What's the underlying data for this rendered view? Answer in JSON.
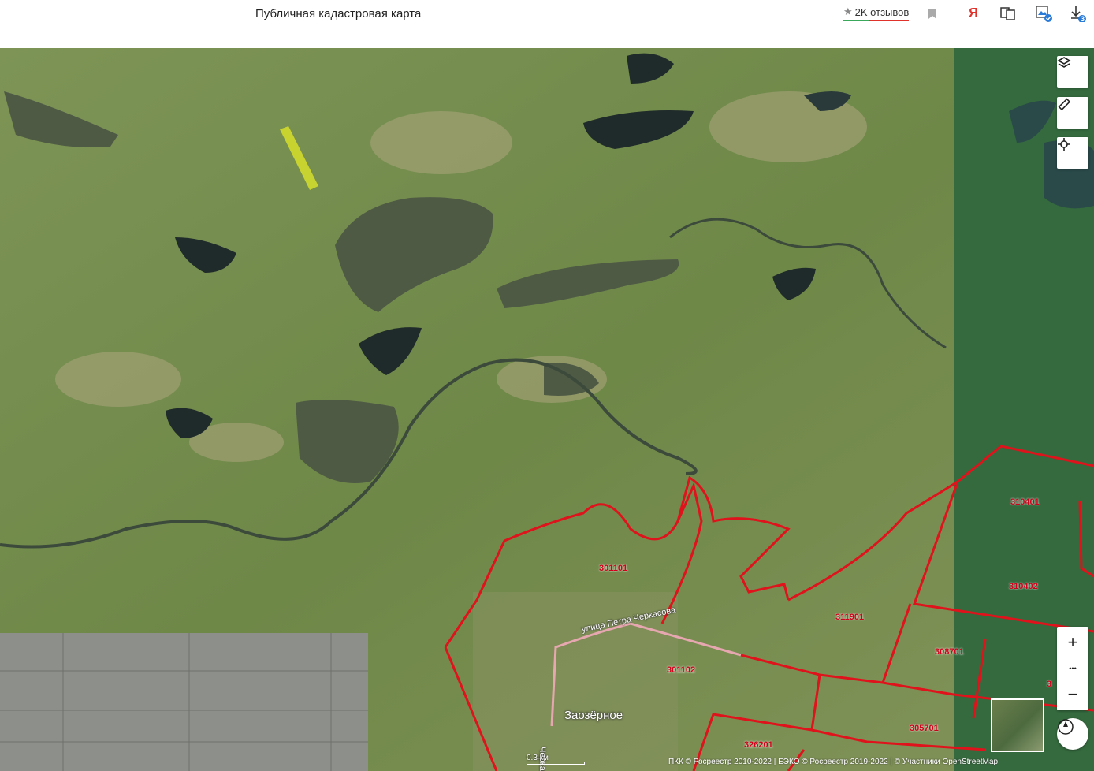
{
  "header": {
    "title": "Публичная кадастровая карта",
    "reviews_label": "2K отзывов",
    "icons": [
      "star-icon",
      "bookmark-icon",
      "yandex-icon",
      "translate-icon",
      "image-check-icon",
      "download-icon"
    ],
    "download_badge": "3"
  },
  "map": {
    "controls": {
      "layers": "layers-icon",
      "measure": "ruler-icon",
      "locate": "locate-icon",
      "zoom_in": "+",
      "more": "•••",
      "zoom_out": "−",
      "compass": "compass-icon"
    },
    "parcels": [
      "310401",
      "310402",
      "301101",
      "311901",
      "308701",
      "301102",
      "305701",
      "326201",
      "3"
    ],
    "place_label": "Заозёрное",
    "street_labels": [
      "улица Петра Черкасова",
      "Черкасова"
    ],
    "scale_label": "0.3 км",
    "attribution": "ПКК © Росреестр 2010-2022 | ЕЭКО © Росреестр 2019-2022 | © Участники OpenStreetMap",
    "colors": {
      "parcel_border": "#e0121b",
      "highlight": "#d6df2a"
    }
  }
}
